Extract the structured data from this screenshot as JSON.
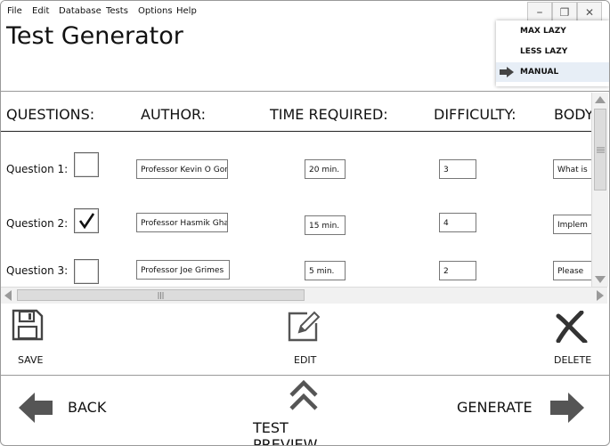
{
  "menu": [
    "File",
    "Edit",
    "Database",
    "Tests",
    "Options",
    "Help"
  ],
  "window_controls": {
    "minimize": "–",
    "restore": "❐",
    "close": "✕"
  },
  "app_title": "Test Generator",
  "mode_menu": {
    "items": [
      "MAX LAZY",
      "LESS LAZY",
      "MANUAL"
    ],
    "selected": "MANUAL"
  },
  "columns": [
    "QUESTIONS:",
    "AUTHOR:",
    "TIME REQUIRED:",
    "DIFFICULTY:",
    "BODY"
  ],
  "rows": [
    {
      "label": "Question 1:",
      "checked": false,
      "author": "Professor Kevin O Gor",
      "time": "20 min.",
      "difficulty": "3",
      "body": "What is"
    },
    {
      "label": "Question 2:",
      "checked": true,
      "author": "Professor Hasmik Gha",
      "time": "15 min.",
      "difficulty": "4",
      "body": "Implem"
    },
    {
      "label": "Question 3:",
      "checked": false,
      "author": "Professor Joe Grimes",
      "time": "5 min.",
      "difficulty": "2",
      "body": "Please"
    }
  ],
  "toolbar": {
    "save": "SAVE",
    "edit": "EDIT",
    "delete": "DELETE"
  },
  "nav": {
    "back": "BACK",
    "preview": "TEST PREVIEW",
    "generate": "GENERATE"
  }
}
